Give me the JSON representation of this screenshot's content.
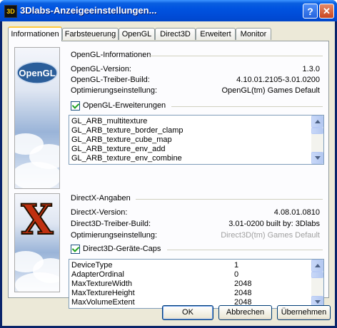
{
  "window": {
    "title": "3Dlabs-Anzeigeeinstellungen...",
    "app_icon": "3D"
  },
  "tabs": [
    "Informationen",
    "Farbsteuerung",
    "OpenGL",
    "Direct3D",
    "Erweitert",
    "Monitor"
  ],
  "opengl": {
    "logo_text": "OpenGL",
    "section_title": "OpenGL-Informationen",
    "rows": [
      {
        "label": "OpenGL-Version:",
        "value": "1.3.0"
      },
      {
        "label": "OpenGL-Treiber-Build:",
        "value": "4.10.01.2105-3.01.0200"
      },
      {
        "label": "Optimierungseinstellung:",
        "value": "OpenGL(tm) Games Default"
      }
    ],
    "ext_checkbox_label": "OpenGL-Erweiterungen",
    "extensions": [
      "GL_ARB_multitexture",
      "GL_ARB_texture_border_clamp",
      "GL_ARB_texture_cube_map",
      "GL_ARB_texture_env_add",
      "GL_ARB_texture_env_combine"
    ]
  },
  "directx": {
    "logo_text": "X",
    "section_title": "DirectX-Angaben",
    "rows": [
      {
        "label": "DirectX-Version:",
        "value": "4.08.01.0810"
      },
      {
        "label": "Direct3D-Treiber-Build:",
        "value": "3.01-0200 built by: 3Dlabs"
      },
      {
        "label": "Optimierungseinstellung:",
        "value": "Direct3D(tm) Games Default"
      }
    ],
    "caps_checkbox_label": "Direct3D-Geräte-Caps",
    "caps": [
      {
        "name": "DeviceType",
        "value": "1"
      },
      {
        "name": "AdapterOrdinal",
        "value": "0"
      },
      {
        "name": "MaxTextureWidth",
        "value": "2048"
      },
      {
        "name": "MaxTextureHeight",
        "value": "2048"
      },
      {
        "name": "MaxVolumeExtent",
        "value": "2048"
      }
    ]
  },
  "buttons": {
    "ok": "OK",
    "cancel": "Abbrechen",
    "apply": "Übernehmen"
  }
}
